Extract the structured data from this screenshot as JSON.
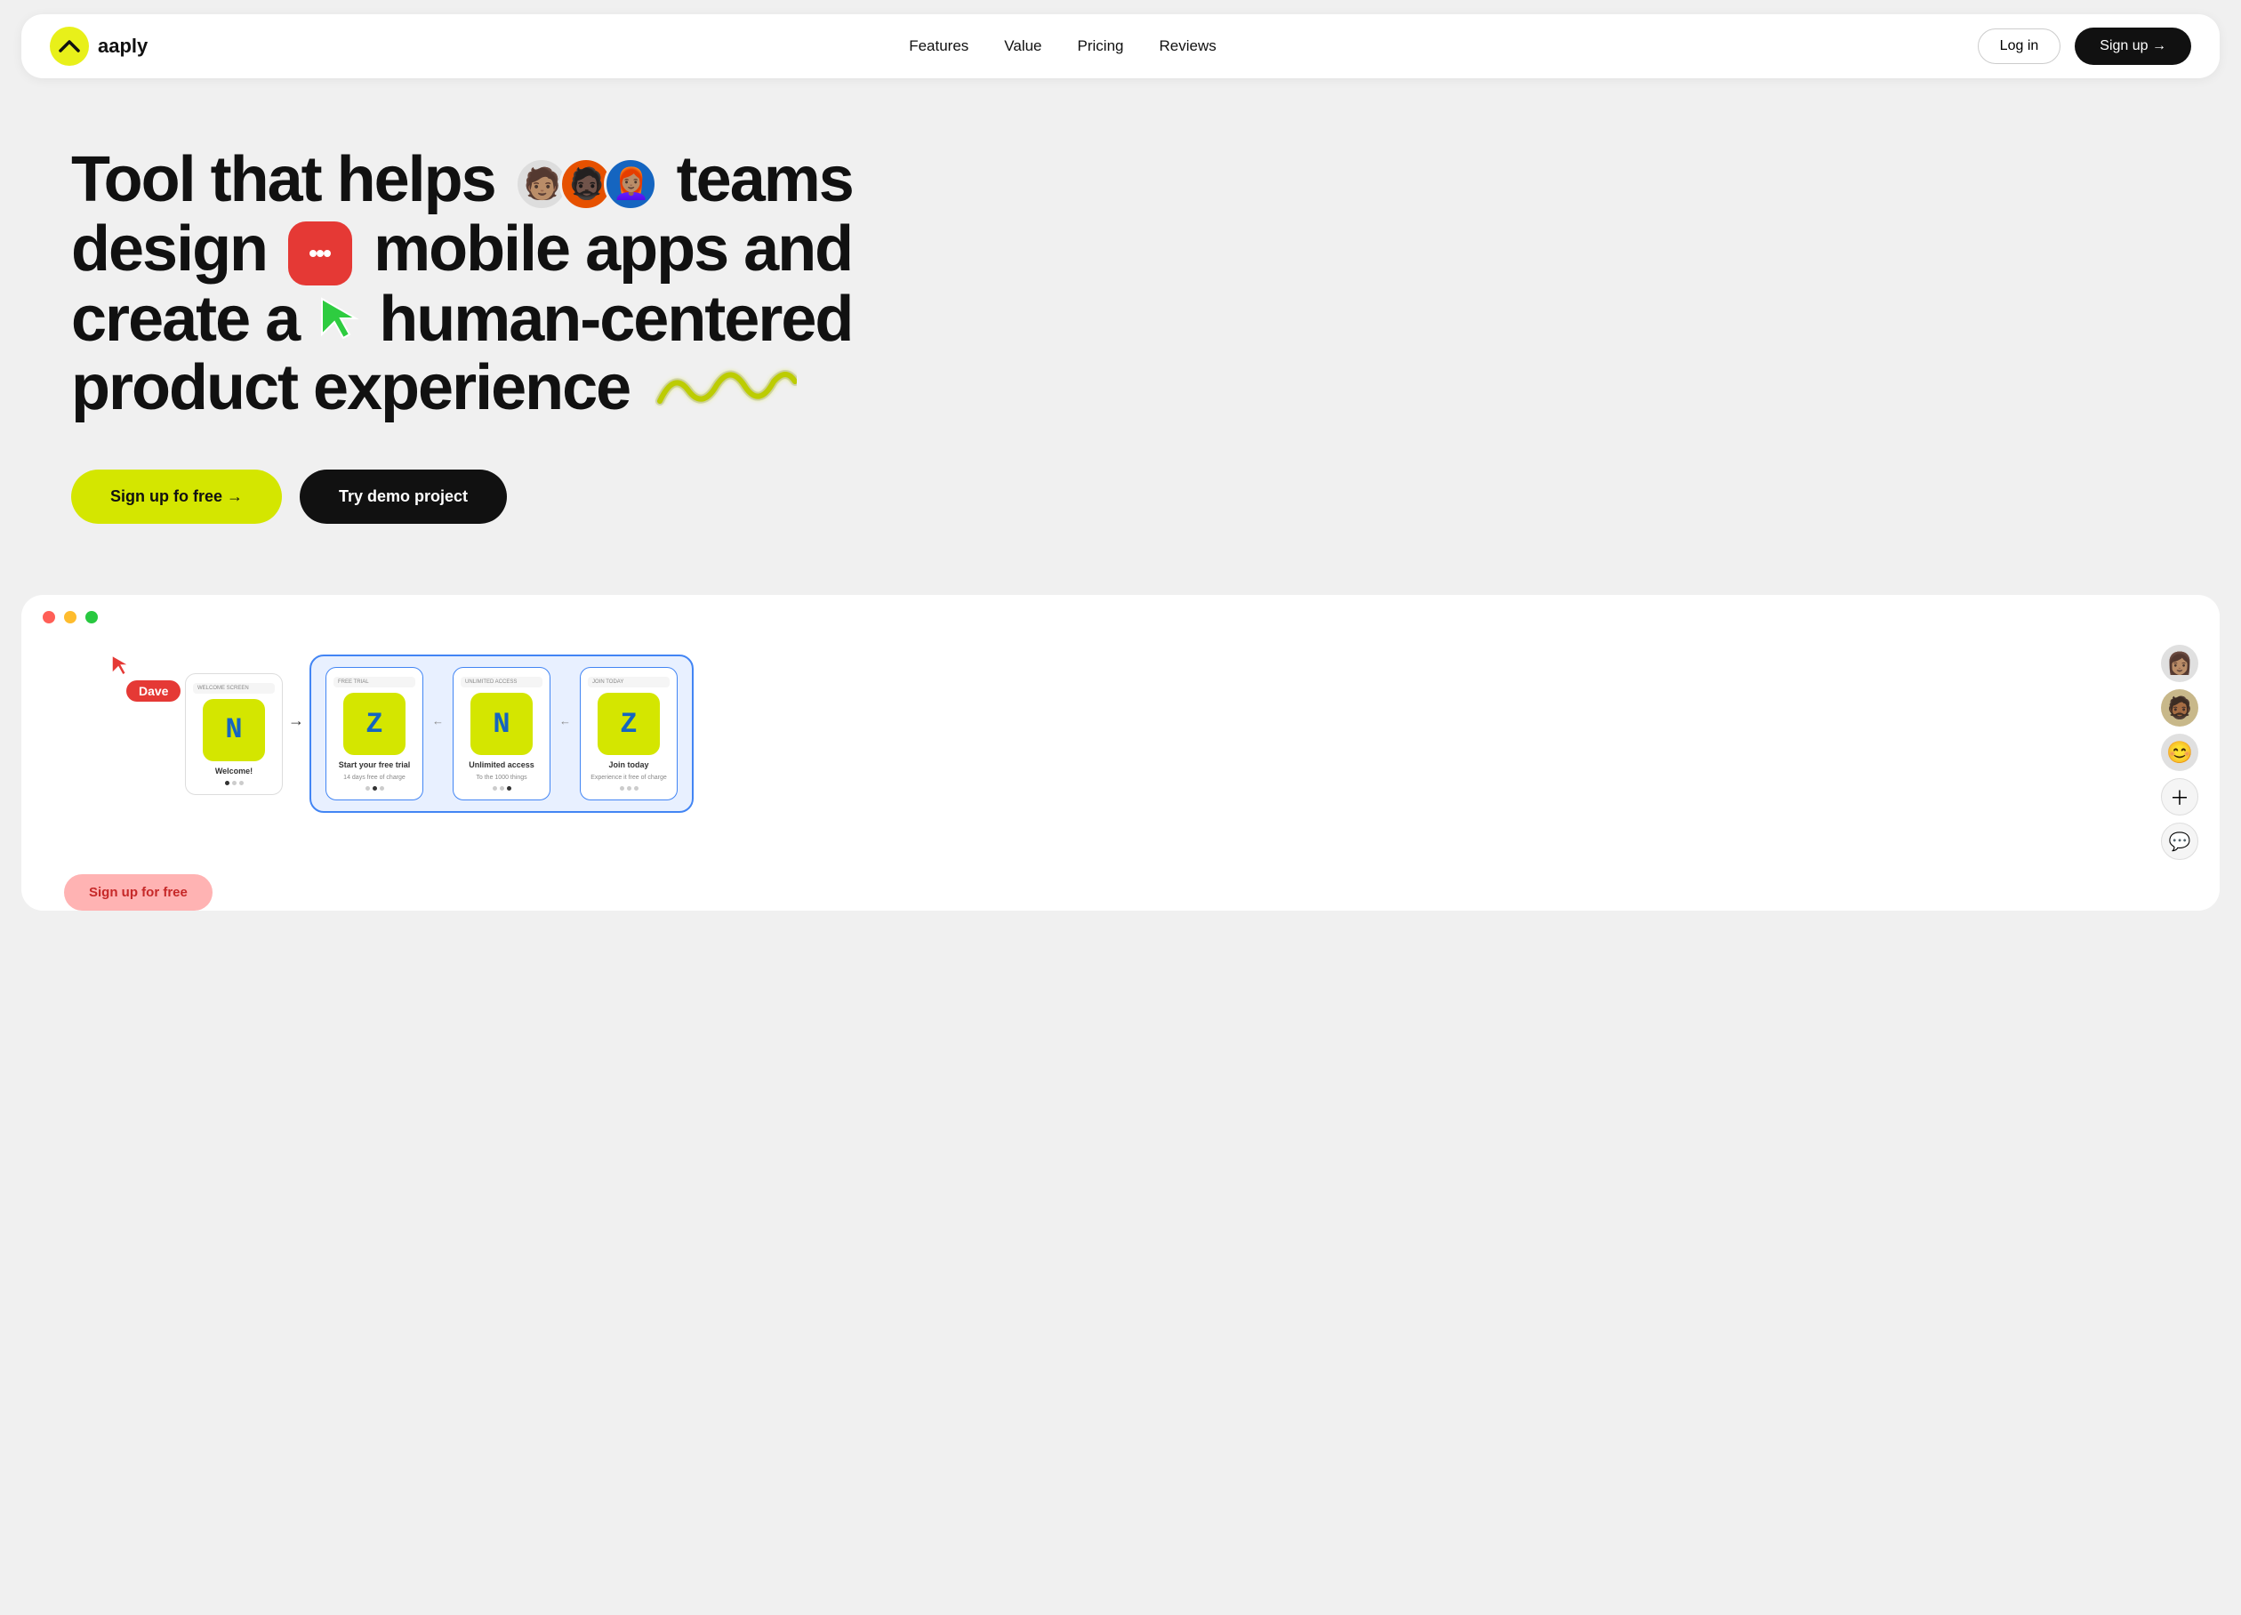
{
  "navbar": {
    "logo_text": "aaply",
    "logo_icon": "^",
    "nav_links": [
      {
        "label": "Features",
        "href": "#"
      },
      {
        "label": "Value",
        "href": "#"
      },
      {
        "label": "Pricing",
        "href": "#"
      },
      {
        "label": "Reviews",
        "href": "#"
      }
    ],
    "login_label": "Log in",
    "signup_label": "Sign up →"
  },
  "hero": {
    "heading_part1": "Tool that helps",
    "heading_part2": "teams",
    "heading_part3": "design",
    "heading_part4": "mobile apps and",
    "heading_part5": "create a",
    "heading_part6": "human-centered",
    "heading_part7": "product experience",
    "cta_primary": "Sign up fo free →",
    "cta_secondary": "Try demo project"
  },
  "preview": {
    "cursor_label": "Dave",
    "window_controls": [
      "red",
      "yellow",
      "green"
    ],
    "screens": [
      {
        "title": "WELCOME SCREEN",
        "app_letter": "N",
        "label": "Welcome!",
        "dots": [
          true,
          false,
          false
        ]
      },
      {
        "title": "FREE TRIAL",
        "app_letter": "Z",
        "label": "Start your free trial",
        "sublabel": "14 days free of charge",
        "dots": [
          false,
          true,
          false
        ]
      },
      {
        "title": "UNLIMITED ACCESS",
        "app_letter": "N",
        "label": "Unlimited access",
        "sublabel": "To the 1000 things",
        "dots": [
          false,
          false,
          true
        ]
      },
      {
        "title": "JOIN TODAY",
        "app_letter": "Z",
        "label": "Join today",
        "sublabel": "Experience it free of charge",
        "dots": [
          false,
          false,
          false
        ]
      }
    ],
    "right_avatars": [
      "👩🏽",
      "🧔🏾",
      "😊"
    ],
    "add_button": "+",
    "chat_icon": "💬",
    "bottom_cta": "Sign up for free"
  },
  "colors": {
    "accent_yellow": "#d4e600",
    "accent_blue": "#4285f4",
    "dark": "#111111",
    "red": "#e53935",
    "bg": "#f0f0f0"
  }
}
